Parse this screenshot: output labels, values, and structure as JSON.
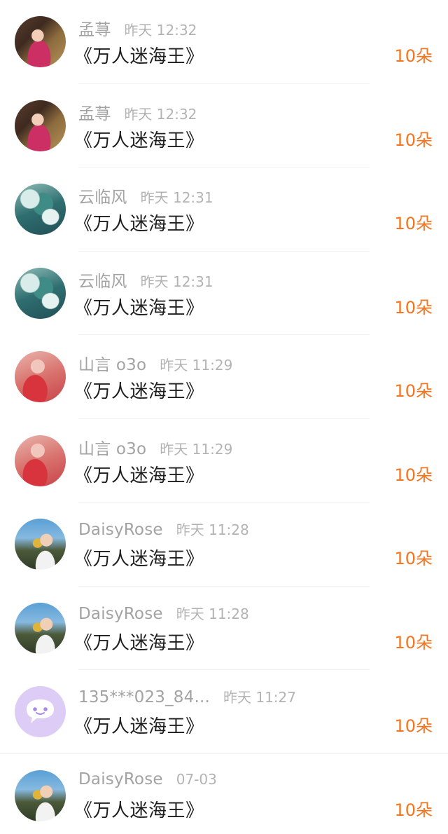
{
  "gifts": [
    {
      "avatar": "avatar-girl-portrait",
      "name": "孟荨",
      "time": "昨天 12:32",
      "work": "《万人迷海王》",
      "amount": "10朵"
    },
    {
      "avatar": "avatar-girl-portrait",
      "name": "孟荨",
      "time": "昨天 12:32",
      "work": "《万人迷海王》",
      "amount": "10朵"
    },
    {
      "avatar": "avatar-sea-waves",
      "name": "云临风",
      "time": "昨天 12:31",
      "work": "《万人迷海王》",
      "amount": "10朵"
    },
    {
      "avatar": "avatar-sea-waves",
      "name": "云临风",
      "time": "昨天 12:31",
      "work": "《万人迷海王》",
      "amount": "10朵"
    },
    {
      "avatar": "avatar-red-blur",
      "name": "山言 o3o",
      "time": "昨天 11:29",
      "work": "《万人迷海王》",
      "amount": "10朵"
    },
    {
      "avatar": "avatar-red-blur",
      "name": "山言 o3o",
      "time": "昨天 11:29",
      "work": "《万人迷海王》",
      "amount": "10朵"
    },
    {
      "avatar": "avatar-daisy-flower",
      "name": "DaisyRose",
      "time": "昨天 11:28",
      "work": "《万人迷海王》",
      "amount": "10朵"
    },
    {
      "avatar": "avatar-daisy-flower",
      "name": "DaisyRose",
      "time": "昨天 11:28",
      "work": "《万人迷海王》",
      "amount": "10朵"
    },
    {
      "avatar": "avatar-default-chat-bubble",
      "name": "135***023_84...",
      "time": "昨天 11:27",
      "work": "《万人迷海王》",
      "amount": "10朵"
    },
    {
      "avatar": "avatar-daisy-flower",
      "name": "DaisyRose",
      "time": "07-03",
      "work": "《万人迷海王》",
      "amount": "10朵"
    }
  ],
  "colors": {
    "accent_orange": "#f5741f",
    "name_gray": "#a3a3a3",
    "time_gray": "#b3b3b3",
    "title_black": "#1e1e1e",
    "default_avatar_lavender": "#ddcdf6"
  }
}
